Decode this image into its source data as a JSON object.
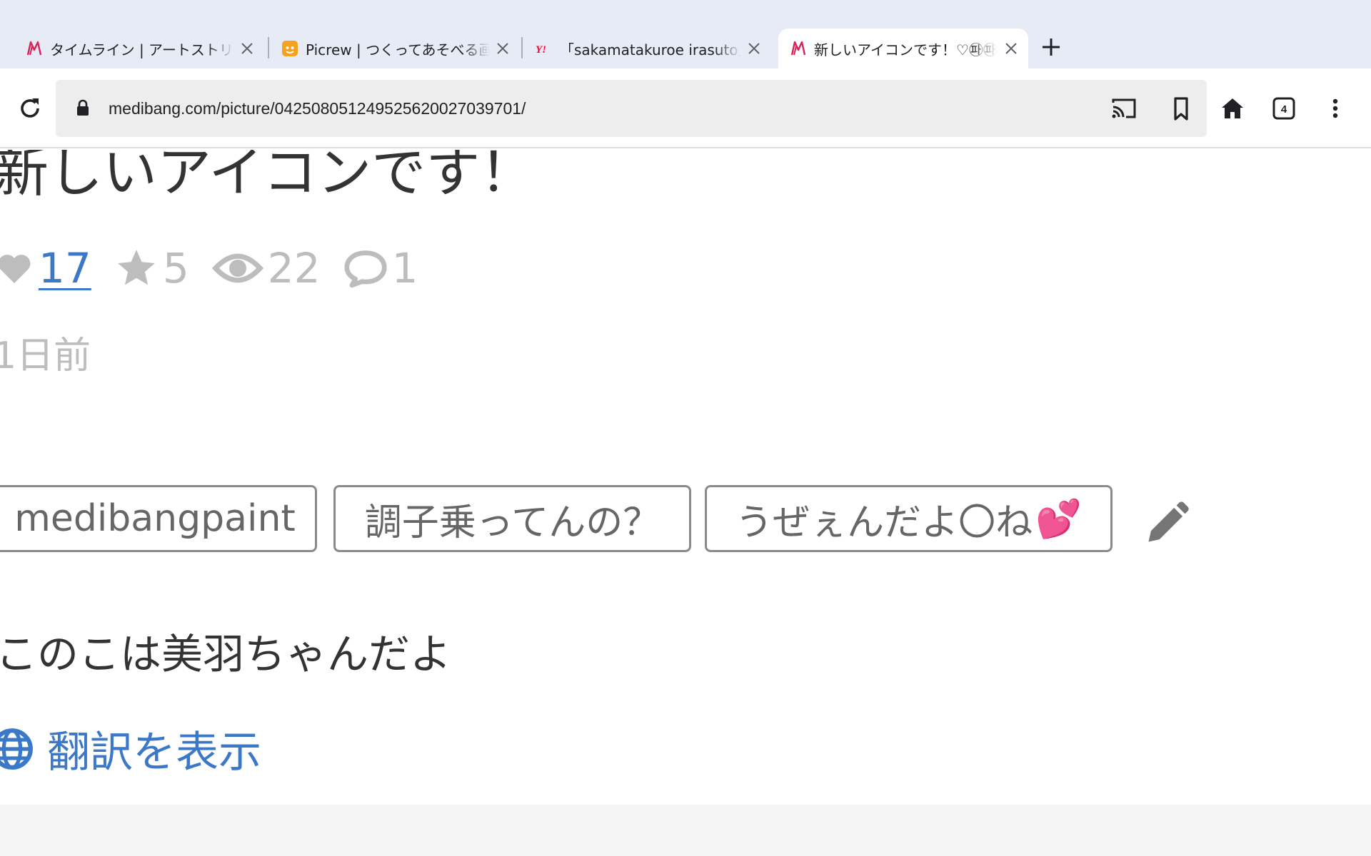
{
  "browser": {
    "tabs": [
      {
        "title": "タイムライン | アートストリート"
      },
      {
        "title": "Picrew | つくってあそべる画像メーカー"
      },
      {
        "title": "「sakamatakuroe irasuto」の検索結果"
      },
      {
        "title": "新しいアイコンです！♡㉺㉺"
      }
    ],
    "url": "medibang.com/picture/042508051249525620027039701/",
    "tab_count": "4"
  },
  "post": {
    "title": "新しいアイコンです！",
    "stats": {
      "likes": "17",
      "favorites": "5",
      "views": "22",
      "comments": "1"
    },
    "time_ago": "1日前",
    "tags": [
      {
        "label": "medibangpaint"
      },
      {
        "label": "調子乗ってんの？"
      },
      {
        "label": "うぜぇんだよ〇ね",
        "emoji": "💕"
      }
    ],
    "caption": "このこは美羽ちゃんだよ",
    "translate_label": "翻訳を表示"
  },
  "colors": {
    "link": "#3c78c8",
    "muted": "#bdbdbd",
    "medibang_brand": "#d6245a",
    "yahoo_red": "#ff0033",
    "picrew_orange": "#f6a21c"
  }
}
